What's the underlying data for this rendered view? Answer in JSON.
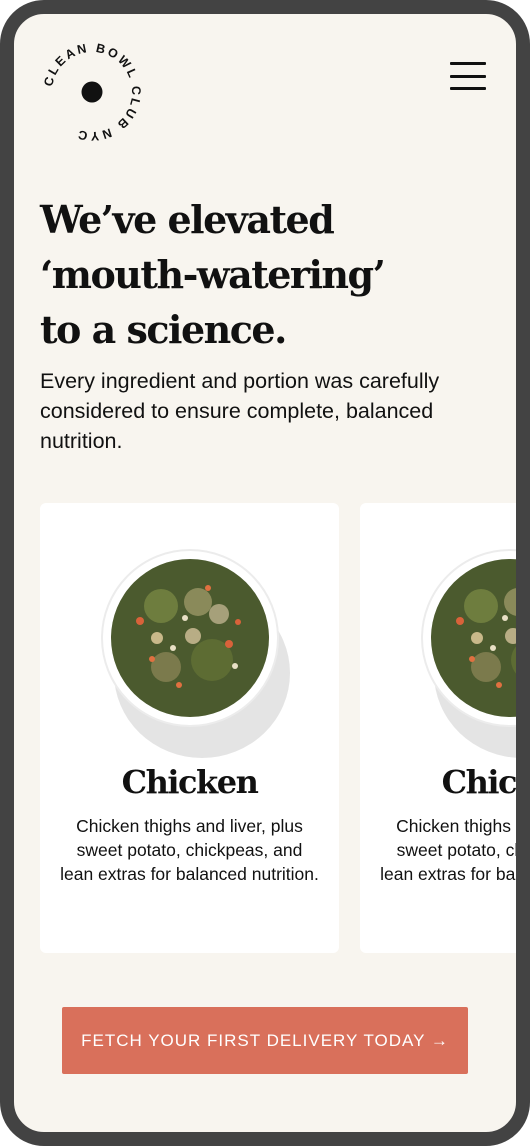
{
  "header": {
    "logo_text": "CLEAN BOWL CLUB NYC",
    "menu_icon": "hamburger-menu-icon"
  },
  "hero": {
    "headline_line1": "We’ve elevated",
    "headline_line2": "‘mouth-watering’",
    "headline_line3": "to a science.",
    "subtext": "Every ingredient and portion was carefully considered to ensure complete, balanced nutrition."
  },
  "cards": [
    {
      "title": "Chicken",
      "description": "Chicken thighs and liver, plus sweet potato, chickpeas, and lean extras for balanced nutrition.",
      "image_icon": "food-bowl-image"
    },
    {
      "title": "Chicken",
      "description": "Chicken thighs and liver, plus sweet potato, chickpeas, and lean extras for balanced nutrition.",
      "image_icon": "food-bowl-image"
    }
  ],
  "cta": {
    "label": "FETCH YOUR FIRST DELIVERY TODAY →"
  },
  "colors": {
    "background": "#f8f5ef",
    "frame": "#434343",
    "accent": "#d9705b",
    "text": "#111111",
    "card": "#ffffff"
  }
}
